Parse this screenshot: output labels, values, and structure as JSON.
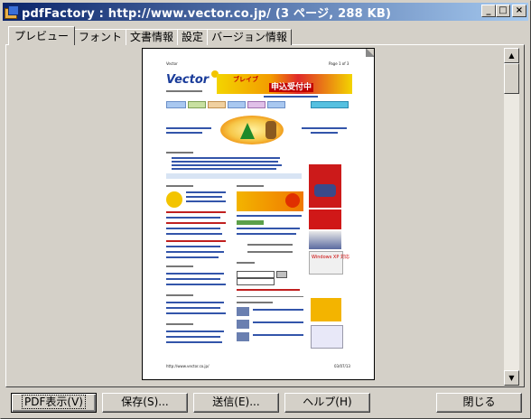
{
  "window": {
    "title": "pdfFactory : http://www.vector.co.jp/ (3 ページ, 288 KB)",
    "minimize_label": "_",
    "maximize_label": "□",
    "close_label": "×"
  },
  "tabs": [
    {
      "label": "プレビュー",
      "active": true
    },
    {
      "label": "フォント"
    },
    {
      "label": "文書情報"
    },
    {
      "label": "設定"
    },
    {
      "label": "バージョン情報"
    }
  ],
  "scrollbar": {
    "up": "▲",
    "down": "▼"
  },
  "page_preview": {
    "header_left": "Vector",
    "header_right": "Page 1 of 3",
    "logo_text": "Vector",
    "banner_text": "申込受付中",
    "banner_sub": "ブレイブ",
    "footer_left": "http://www.vector.co.jp/",
    "footer_right": "03/07/13",
    "ad_text": "Windows XP 対応"
  },
  "buttons": {
    "pdf_view": "PDF表示(V)",
    "save": "保存(S)...",
    "send": "送信(E)...",
    "help": "ヘルプ(H)",
    "close": "閉じる"
  }
}
